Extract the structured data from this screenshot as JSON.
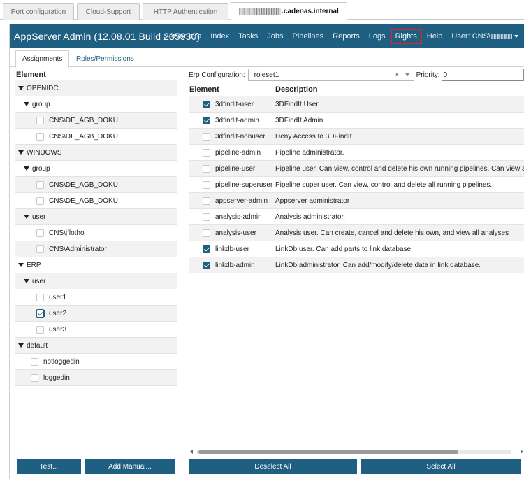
{
  "browser_tabs": [
    {
      "label": "Port configuration"
    },
    {
      "label": "Cloud-Support"
    },
    {
      "label": "HTTP Authentication"
    },
    {
      "label": ".cadenas.internal"
    }
  ],
  "header": {
    "title": "AppServer Admin (12.08.01 Build 235930)",
    "nav": [
      "Server Info",
      "Index",
      "Tasks",
      "Jobs",
      "Pipelines",
      "Reports",
      "Logs",
      "Rights",
      "Help"
    ],
    "selected_nav": "Rights",
    "user_label": "User: CNS\\"
  },
  "subtabs": [
    "Assignments",
    "Roles/Permissions"
  ],
  "tree": {
    "header": "Element",
    "nodes": [
      {
        "label": "OPENIDC"
      },
      {
        "label": "group"
      },
      {
        "label": "CNS\\DE_AGB_DOKU",
        "checked": false
      },
      {
        "label": "CNS\\DE_AGB_DOKU",
        "checked": false
      },
      {
        "label": "WINDOWS"
      },
      {
        "label": "group"
      },
      {
        "label": "CNS\\DE_AGB_DOKU",
        "checked": false
      },
      {
        "label": "CNS\\DE_AGB_DOKU",
        "checked": false
      },
      {
        "label": "user"
      },
      {
        "label": "CNS\\jflotho",
        "checked": false
      },
      {
        "label": "CNS\\Administrator",
        "checked": false
      },
      {
        "label": "ERP"
      },
      {
        "label": "user"
      },
      {
        "label": "user1",
        "checked": false
      },
      {
        "label": "user2",
        "checked": true
      },
      {
        "label": "user3",
        "checked": false
      },
      {
        "label": "default"
      },
      {
        "label": "notloggedin",
        "checked": false
      },
      {
        "label": "loggedin",
        "checked": false
      }
    ]
  },
  "erp": {
    "label": "Erp Configuration:",
    "value": "roleset1",
    "clear_glyph": "×",
    "priority_label": "Priority:",
    "priority_value": "0"
  },
  "grid": {
    "headers": [
      "Element",
      "Description"
    ],
    "rows": [
      {
        "element": "3dfindit-user",
        "description": "3DFindIt User",
        "checked": true
      },
      {
        "element": "3dfindit-admin",
        "description": "3DFindIt Admin",
        "checked": true
      },
      {
        "element": "3dfindit-nonuser",
        "description": "Deny Access to 3DFindIt",
        "checked": false
      },
      {
        "element": "pipeline-admin",
        "description": "Pipeline administrator.",
        "checked": false
      },
      {
        "element": "pipeline-user",
        "description": "Pipeline user. Can view, control and delete his own running pipelines. Can view a",
        "checked": false
      },
      {
        "element": "pipeline-superuser",
        "description": "Pipeline super user. Can view, control and delete all running pipelines.",
        "checked": false
      },
      {
        "element": "appserver-admin",
        "description": "Appserver administrator",
        "checked": false
      },
      {
        "element": "analysis-admin",
        "description": "Analysis administrator.",
        "checked": false
      },
      {
        "element": "analysis-user",
        "description": "Analysis user. Can create, cancel and delete his own, and view all analyses",
        "checked": false
      },
      {
        "element": "linkdb-user",
        "description": "LinkDb user. Can add parts to link database.",
        "checked": true
      },
      {
        "element": "linkdb-admin",
        "description": "LinkDb administrator. Can add/modify/delete data in link database.",
        "checked": true
      }
    ]
  },
  "buttons": {
    "test": "Test...",
    "add_manual": "Add Manual...",
    "deselect_all": "Deselect All",
    "select_all": "Select All"
  },
  "colors": {
    "header_bg": "#1e5f82",
    "highlight": "#e8202a"
  }
}
